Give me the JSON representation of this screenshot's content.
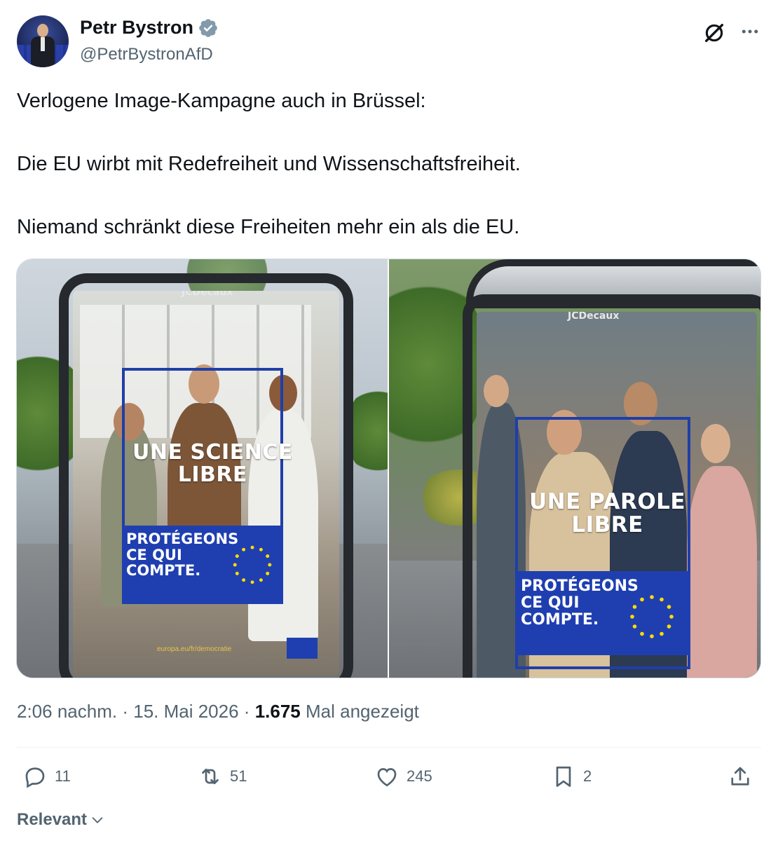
{
  "author": {
    "display_name": "Petr Bystron",
    "handle": "@PetrBystronAfD",
    "verified": true
  },
  "tweet": {
    "lines": [
      "Verlogene Image-Kampagne auch in Brüssel:",
      "Die EU wirbt mit Redefreiheit und Wissenschaftsfreiheit.",
      "Niemand schränkt diese Freiheiten mehr ein als die EU."
    ]
  },
  "media": {
    "left_poster": {
      "brand": "JCDecaux",
      "headline_line1": "UNE SCIENCE",
      "headline_line2": "LIBRE",
      "slogan_line1": "PROTÉGEONS",
      "slogan_line2": "CE QUI",
      "slogan_line3": "COMPTE.",
      "url": "europa.eu/fr/democratie"
    },
    "right_poster": {
      "brand": "JCDecaux",
      "headline_line1": "UNE PAROLE",
      "headline_line2": "LIBRE",
      "slogan_line1": "PROTÉGEONS",
      "slogan_line2": "CE QUI",
      "slogan_line3": "COMPTE."
    }
  },
  "meta": {
    "time": "2:06 nachm.",
    "separator": "·",
    "date": "15. Mai 2026",
    "views_count": "1.675",
    "views_label": "Mal angezeigt"
  },
  "actions": {
    "replies": "11",
    "reposts": "51",
    "likes": "245",
    "bookmarks": "2"
  },
  "sort": {
    "label": "Relevant"
  },
  "colors": {
    "text_primary": "#0f1419",
    "text_secondary": "#536471",
    "verified_blue": "#829aab",
    "eu_blue": "#1f3fb0",
    "eu_star_yellow": "#ffdd00"
  },
  "icons": [
    "verified-badge-icon",
    "grok-icon",
    "more-icon",
    "reply-icon",
    "repost-icon",
    "like-icon",
    "bookmark-icon",
    "share-icon",
    "chevron-down-icon"
  ]
}
